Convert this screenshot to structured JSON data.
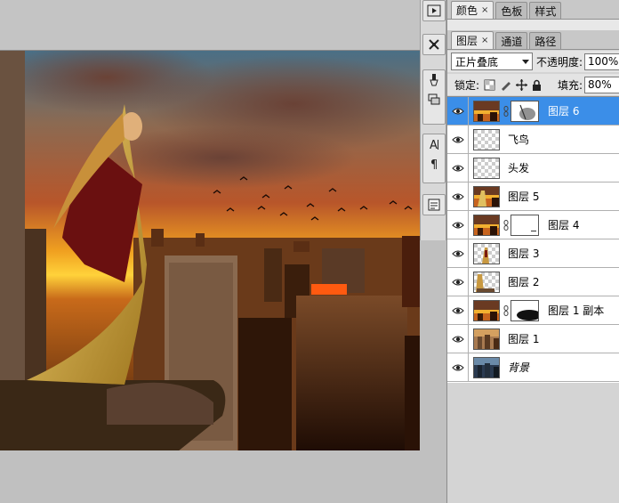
{
  "panels": {
    "color_tabs": [
      {
        "label": "颜色",
        "closable": true,
        "active": true
      },
      {
        "label": "色板",
        "closable": false,
        "active": false
      },
      {
        "label": "样式",
        "closable": false,
        "active": false
      }
    ],
    "layer_tabs": [
      {
        "label": "图层",
        "closable": true,
        "active": true
      },
      {
        "label": "通道",
        "closable": false,
        "active": false
      },
      {
        "label": "路径",
        "closable": false,
        "active": false
      }
    ],
    "close_glyph": "×"
  },
  "layers_options": {
    "blend_mode": "正片叠底",
    "opacity_label": "不透明度:",
    "opacity_value": "100%",
    "lock_label": "锁定:",
    "fill_label": "填充:",
    "fill_value": "80%"
  },
  "layers": [
    {
      "name": "图层 6",
      "thumb": "sunset",
      "mask": "soft",
      "selected": true
    },
    {
      "name": "飞鸟",
      "thumb": "transparent",
      "mask": null,
      "selected": false
    },
    {
      "name": "头发",
      "thumb": "transparent",
      "mask": null,
      "selected": false
    },
    {
      "name": "图层 5",
      "thumb": "sunset-figure",
      "mask": null,
      "selected": false
    },
    {
      "name": "图层 4",
      "thumb": "sunset",
      "mask": "white",
      "selected": false
    },
    {
      "name": "图层 3",
      "thumb": "figure-small",
      "mask": null,
      "selected": false
    },
    {
      "name": "图层 2",
      "thumb": "figure-left",
      "mask": null,
      "selected": false
    },
    {
      "name": "图层 1 副本",
      "thumb": "sunset",
      "mask": "dark",
      "selected": false
    },
    {
      "name": "图层 1",
      "thumb": "city",
      "mask": null,
      "selected": false
    },
    {
      "name": "背景",
      "thumb": "blue-city",
      "mask": null,
      "selected": false,
      "italic": true
    }
  ],
  "tools": [
    "play-icon",
    "tool-preset-icon",
    "brush-icon",
    "clone-stamp-icon",
    "character-icon",
    "paragraph-icon",
    "notes-icon"
  ],
  "colors": {
    "selected_row": "#3b8ee8",
    "panel_bg": "#d4d4d4"
  }
}
